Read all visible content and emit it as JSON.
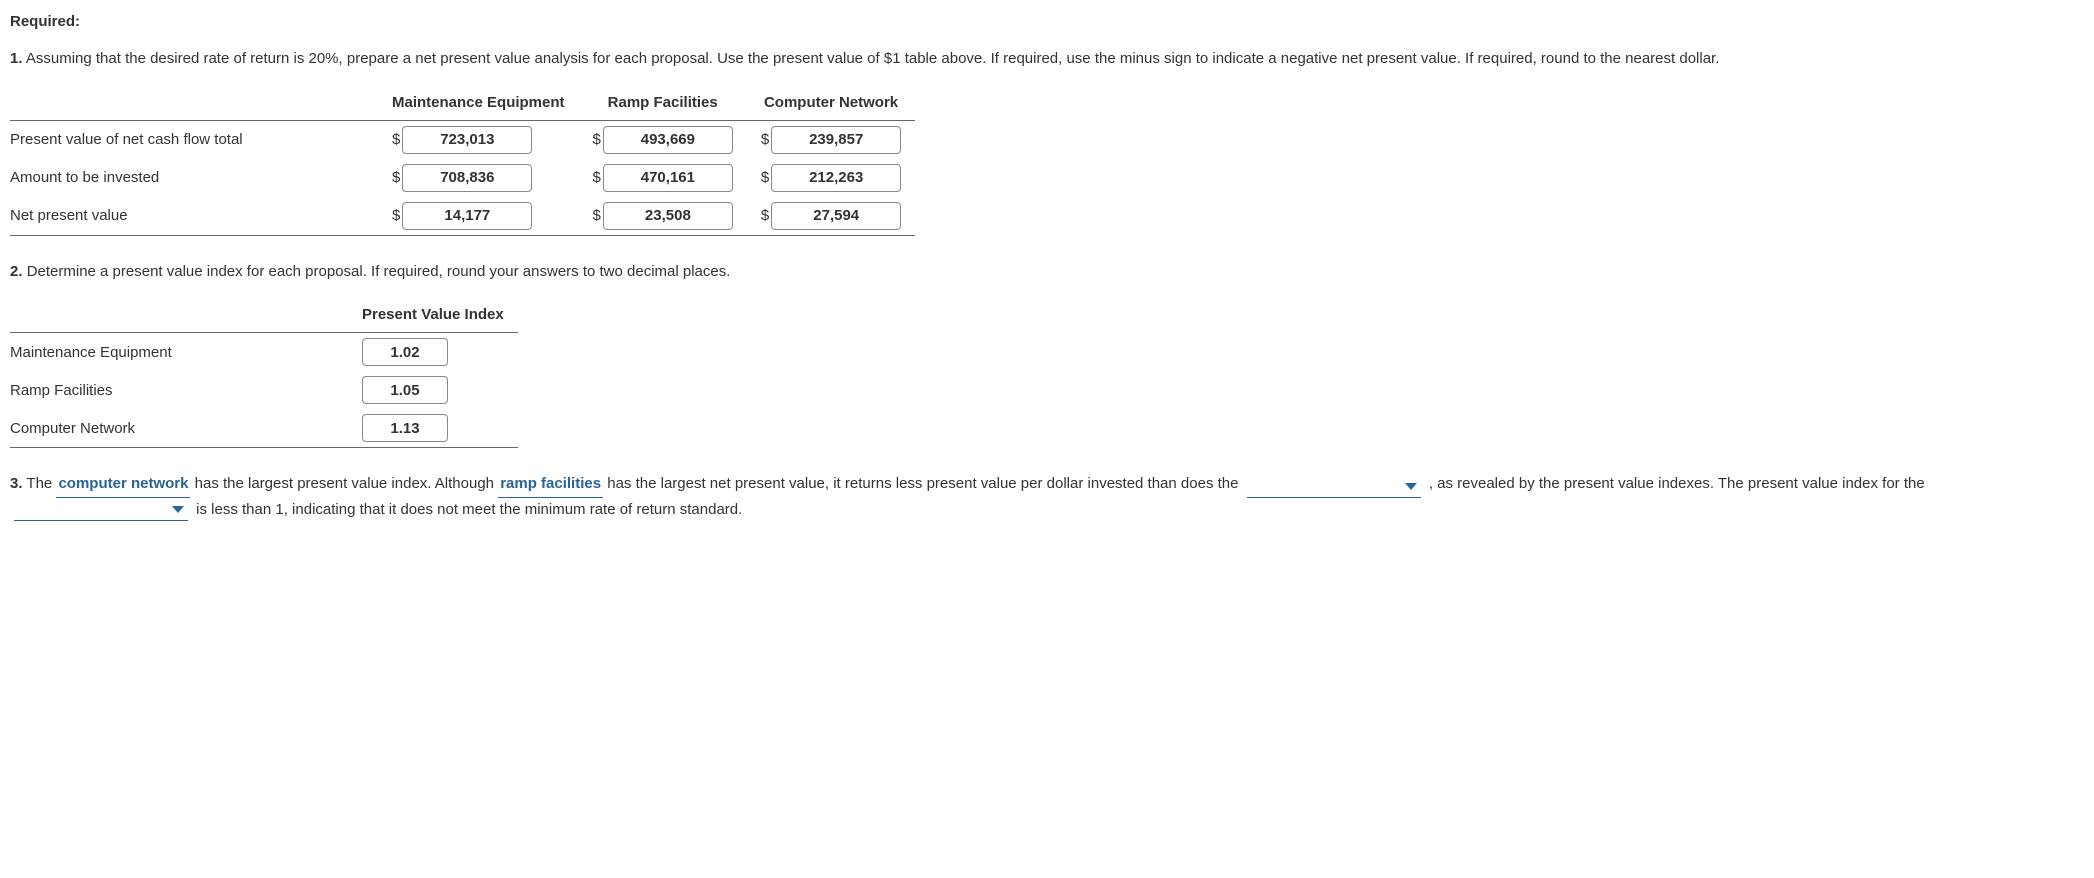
{
  "heading": "Required:",
  "q1": {
    "num": "1.",
    "text": "Assuming that the desired rate of return is 20%, prepare a net present value analysis for each proposal. Use the present value of $1 table above. If required, use the minus sign to indicate a negative net present value. If required, round to the nearest dollar.",
    "cols": {
      "c1": "Maintenance Equipment",
      "c2": "Ramp Facilities",
      "c3": "Computer Network"
    },
    "rows": {
      "r1": {
        "label": "Present value of net cash flow total",
        "v1": "723,013",
        "v2": "493,669",
        "v3": "239,857"
      },
      "r2": {
        "label": "Amount to be invested",
        "v1": "708,836",
        "v2": "470,161",
        "v3": "212,263"
      },
      "r3": {
        "label": "Net present value",
        "v1": "14,177",
        "v2": "23,508",
        "v3": "27,594"
      }
    },
    "currency": "$"
  },
  "q2": {
    "num": "2.",
    "text": "Determine a present value index for each proposal. If required, round your answers to two decimal places.",
    "header": "Present Value Index",
    "rows": {
      "r1": {
        "label": "Maintenance Equipment",
        "v": "1.02"
      },
      "r2": {
        "label": "Ramp Facilities",
        "v": "1.05"
      },
      "r3": {
        "label": "Computer Network",
        "v": "1.13"
      }
    }
  },
  "q3": {
    "num": "3.",
    "t1": "The ",
    "answer1": "computer network",
    "t2": " has the largest present value index. Although ",
    "answer2": "ramp facilities",
    "t3": " has the largest net present value, it returns less present value per dollar invested than does the ",
    "t4": ", as revealed by the present value indexes. The present value index for the ",
    "t5": " is less than 1, indicating that it does not meet the minimum rate of return standard."
  }
}
